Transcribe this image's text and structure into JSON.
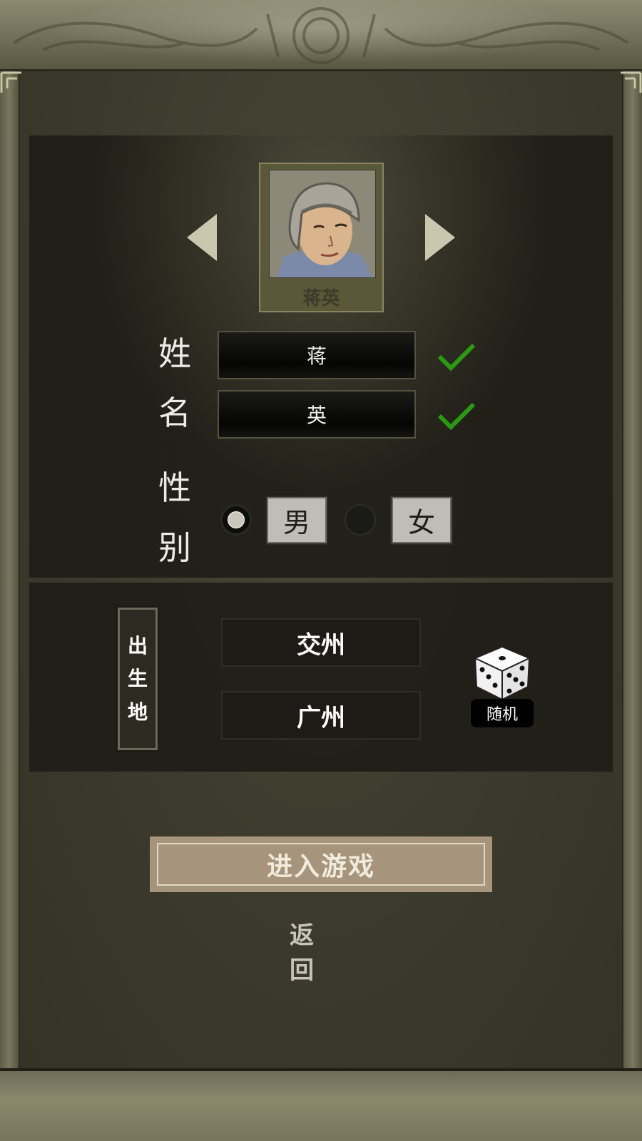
{
  "character": {
    "portrait_name": "蒋英"
  },
  "form": {
    "surname_label": "姓",
    "surname_value": "蒋",
    "given_label": "名",
    "given_value": "英",
    "gender_label_1": "性",
    "gender_label_2": "别",
    "gender_male": "男",
    "gender_female": "女",
    "gender_selected": "男"
  },
  "birthplace": {
    "label_chars": [
      "出",
      "生",
      "地"
    ],
    "region": "交州",
    "city": "广州",
    "random_label": "随机"
  },
  "actions": {
    "enter_game": "进入游戏",
    "back": "返回"
  },
  "icons": {
    "prev": "triangle-left-icon",
    "next": "triangle-right-icon",
    "check": "check-icon",
    "dice": "dice-icon"
  },
  "colors": {
    "check_green": "#2a9a12",
    "enter_button": "#a6957c",
    "frame_stone": "#7a7860"
  }
}
